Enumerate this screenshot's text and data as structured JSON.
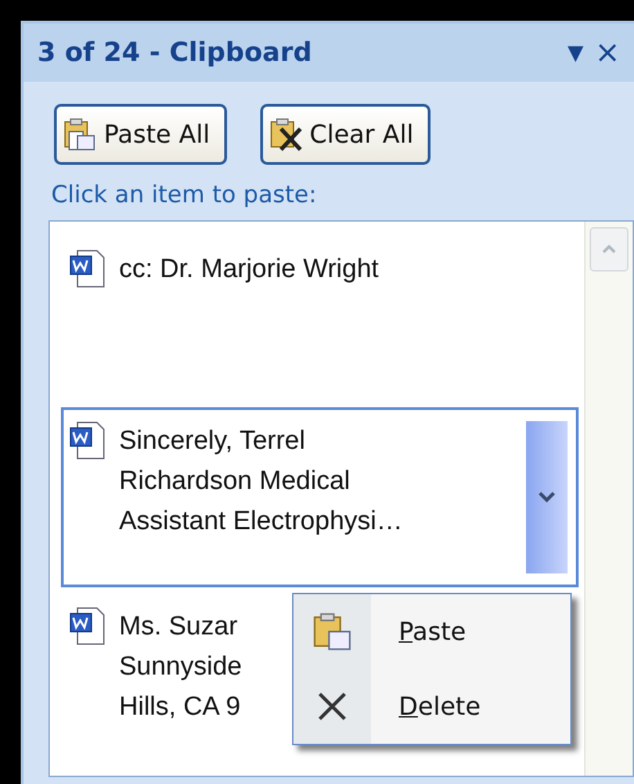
{
  "pane": {
    "title": "3 of 24 - Clipboard",
    "menu_glyph": "▼",
    "close_glyph": "×"
  },
  "buttons": [
    {
      "label": "Paste All",
      "kind": "paste"
    },
    {
      "label": "Clear All",
      "kind": "clear"
    }
  ],
  "instruction": "Click an item to paste:",
  "items": [
    {
      "lines": [
        "cc: Dr. Marjorie Wright"
      ],
      "selected": false
    },
    {
      "lines": [
        "Sincerely, Terrel",
        "Richardson Medical",
        "Assistant Electrophysi…"
      ],
      "selected": true
    },
    {
      "lines": [
        "Ms. Suzar",
        "Sunnyside",
        "Hills, CA 9"
      ],
      "selected": false
    }
  ],
  "context_menu": [
    {
      "label": "Paste",
      "kind": "paste"
    },
    {
      "label": "Delete",
      "kind": "delete"
    }
  ]
}
